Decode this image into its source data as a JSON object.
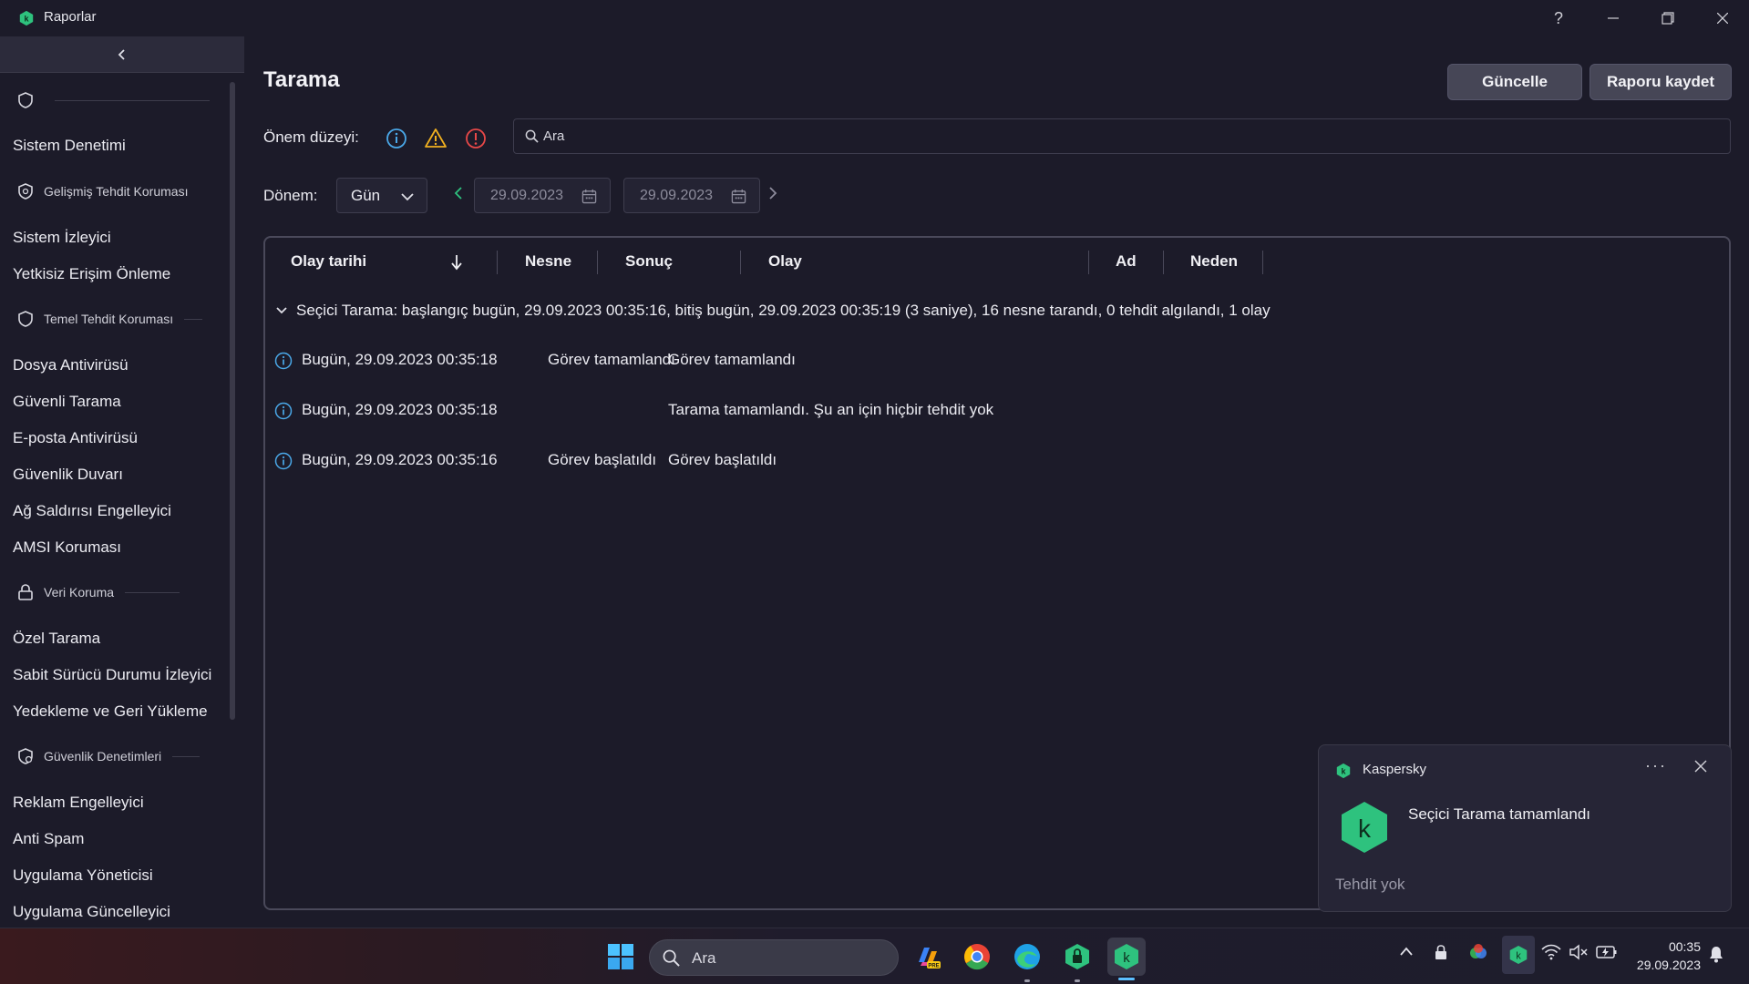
{
  "window": {
    "title": "Raporlar"
  },
  "sidebar": {
    "items": [
      {
        "type": "section",
        "label": "",
        "icon": "shield-icon"
      },
      {
        "type": "item",
        "label": "Sistem Denetimi"
      },
      {
        "type": "section",
        "label": "Gelişmiş Tehdit Koruması",
        "icon": "shield-advanced-icon"
      },
      {
        "type": "item",
        "label": "Sistem İzleyici"
      },
      {
        "type": "item",
        "label": "Yetkisiz Erişim Önleme"
      },
      {
        "type": "section",
        "label": "Temel Tehdit Koruması",
        "icon": "shield-basic-icon"
      },
      {
        "type": "item",
        "label": "Dosya Antivirüsü"
      },
      {
        "type": "item",
        "label": "Güvenli Tarama"
      },
      {
        "type": "item",
        "label": "E-posta Antivirüsü"
      },
      {
        "type": "item",
        "label": "Güvenlik Duvarı"
      },
      {
        "type": "item",
        "label": "Ağ Saldırısı Engelleyici"
      },
      {
        "type": "item",
        "label": "AMSI Koruması"
      },
      {
        "type": "section",
        "label": "Veri Koruma",
        "icon": "lock-icon"
      },
      {
        "type": "item",
        "label": "Özel Tarama"
      },
      {
        "type": "item",
        "label": "Sabit Sürücü Durumu İzleyici"
      },
      {
        "type": "item",
        "label": "Yedekleme ve Geri Yükleme"
      },
      {
        "type": "section",
        "label": "Güvenlik Denetimleri",
        "icon": "shield-check-icon"
      },
      {
        "type": "item",
        "label": "Reklam Engelleyici"
      },
      {
        "type": "item",
        "label": "Anti Spam"
      },
      {
        "type": "item",
        "label": "Uygulama Yöneticisi"
      },
      {
        "type": "item",
        "label": "Uygulama Güncelleyici"
      }
    ]
  },
  "main": {
    "title": "Tarama",
    "buttons": {
      "update": "Güncelle",
      "save_report": "Raporu kaydet"
    },
    "severity_label": "Önem düzeyi:",
    "search_placeholder": "Ara",
    "period_label": "Dönem:",
    "period_value": "Gün",
    "date_from": "29.09.2023",
    "date_to": "29.09.2023"
  },
  "table": {
    "columns": {
      "event_date": "Olay tarihi",
      "object": "Nesne",
      "result": "Sonuç",
      "event": "Olay",
      "name": "Ad",
      "reason": "Neden"
    },
    "group_text": "Seçici Tarama: başlangıç bugün, 29.09.2023 00:35:16, bitiş bugün, 29.09.2023 00:35:19 (3 saniye), 16 nesne tarandı, 0 tehdit algılandı, 1 olay",
    "rows": [
      {
        "date": "Bugün, 29.09.2023 00:35:18",
        "result": "Görev tamamlandı",
        "event": "Görev tamamlandı"
      },
      {
        "date": "Bugün, 29.09.2023 00:35:18",
        "result": "",
        "event": "Tarama tamamlandı. Şu an için hiçbir tehdit yok"
      },
      {
        "date": "Bugün, 29.09.2023 00:35:16",
        "result": "Görev başlatıldı",
        "event": "Görev başlatıldı"
      }
    ]
  },
  "toast": {
    "app": "Kaspersky",
    "more": "···",
    "title": "Seçici Tarama tamamlandı",
    "body": "Tehdit yok"
  },
  "taskbar": {
    "search_placeholder": "Ara",
    "time": "00:35",
    "date": "29.09.2023"
  },
  "colors": {
    "background": "#1c1b29",
    "kaspersky_green": "#2ec27e",
    "info_blue": "#4aa8e8",
    "warning_yellow": "#f0b020",
    "error_red": "#e84848"
  }
}
